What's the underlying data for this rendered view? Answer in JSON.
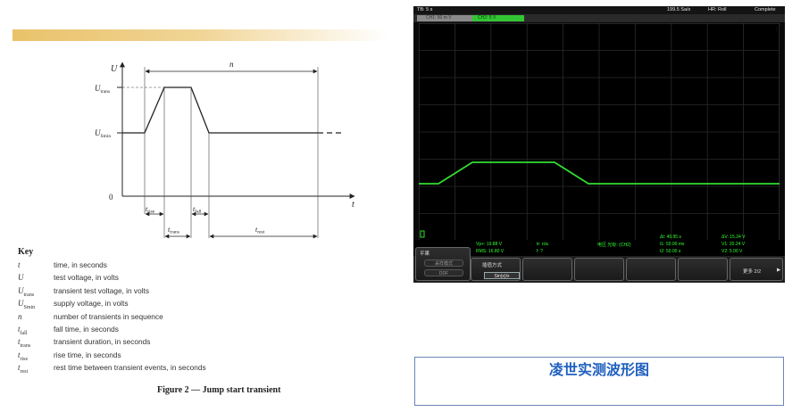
{
  "diagram": {
    "y_axis": "U",
    "x_axis": "t",
    "n_label": "n",
    "u_trans": "U",
    "u_trans_sub": "trans",
    "u_smin": "U",
    "u_smin_sub": "Smin",
    "zero": "0",
    "t_rise": "t",
    "t_rise_sub": "rise",
    "t_fall": "t",
    "t_fall_sub": "fall",
    "t_trans": "t",
    "t_trans_sub": "trans",
    "t_rest": "t",
    "t_rest_sub": "rest"
  },
  "key": {
    "title": "Key",
    "items": [
      {
        "sym": "t",
        "sub": "",
        "desc": "time, in seconds"
      },
      {
        "sym": "U",
        "sub": "",
        "desc": "test voltage, in volts"
      },
      {
        "sym": "U",
        "sub": "trans",
        "desc": "transient test voltage, in volts"
      },
      {
        "sym": "U",
        "sub": "Smin",
        "desc": "supply voltage, in volts"
      },
      {
        "sym": "n",
        "sub": "",
        "desc": "number of transients in sequence"
      },
      {
        "sym": "t",
        "sub": "fall",
        "desc": "fall time, in seconds"
      },
      {
        "sym": "t",
        "sub": "trans",
        "desc": "transient duration, in seconds"
      },
      {
        "sym": "t",
        "sub": "rise",
        "desc": "rise time, in seconds"
      },
      {
        "sym": "t",
        "sub": "rest",
        "desc": "rest time between transient events, in seconds"
      }
    ]
  },
  "caption": "Figure 2 — Jump start transient",
  "scope": {
    "tb": "TB: 5 s",
    "rate": "199.5 Sa/s",
    "hr": "HR: Roll",
    "status": "Complete",
    "ch1_tab": "CH1: 50 m V",
    "ch2_tab": "CH2: 5 V",
    "trace_color": "#33dd33",
    "meas": {
      "vp": "Vp+: 19.88 V",
      "rms": "RMS: 16.80 V",
      "tr": "tr: n/a",
      "f": "f: ?",
      "src": "电压 光标: (CH2)",
      "dt": "Δt: 49.95 s",
      "t1": "t1: 50.00 ms",
      "t2": "t2: 50.00 s",
      "dv": "ΔV: 15.24 V",
      "v1": "V1: 20.24 V",
      "v2": "V2: 5.00 V"
    },
    "softkeys": {
      "k1_title": "平果",
      "k1_pill1": "采样模式",
      "k1_pill2": "DDF",
      "k2_label": "插值方式",
      "k2_value": "Sin(x)/x",
      "more": "更多 2/2"
    }
  },
  "title_box": "凌世实测波形图"
}
